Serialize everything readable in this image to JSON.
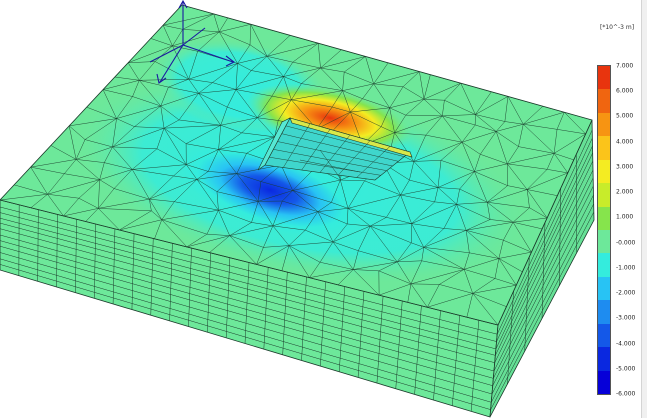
{
  "legend": {
    "unit": "[*10^-3 m]",
    "ticks": [
      "7.000",
      "6.000",
      "5.000",
      "4.000",
      "3.000",
      "2.000",
      "1.000",
      "-0.000",
      "-1.000",
      "-2.000",
      "-3.000",
      "-4.000",
      "-5.000",
      "-6.000"
    ],
    "colors": [
      "#e8340e",
      "#f06510",
      "#f79412",
      "#fbc41a",
      "#f4ec22",
      "#c8ec2a",
      "#86e44c",
      "#6de89a",
      "#34ecdd",
      "#28c3f4",
      "#1e8cf0",
      "#1458e8",
      "#0a28e0",
      "#0600d8"
    ]
  },
  "scene": {
    "field_colors": {
      "background": "#6de89a",
      "cyan": "#34ecdd",
      "blue_deep": "#0a28e0",
      "red_peak": "#e8340e",
      "mesh_line": "#1a3a2a"
    },
    "axis_triad": {
      "icon": "axis-triad-icon",
      "color": "#1a1aa0"
    }
  }
}
